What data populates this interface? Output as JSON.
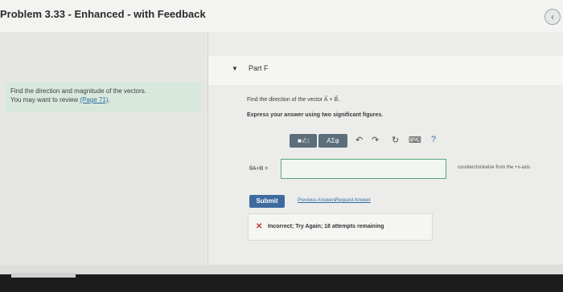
{
  "header": {
    "title": "Problem 3.33 - Enhanced - with Feedback",
    "back_icon": "‹"
  },
  "sidebar": {
    "hint_line1": "Find the direction and magnitude of the vectors.",
    "hint_line2_prefix": "You may want to review ",
    "hint_link": "(Page 71)",
    "hint_line2_suffix": "."
  },
  "part": {
    "caret": "▼",
    "label": "Part F"
  },
  "question": {
    "text": "Find the direction of the vector A⃗ + B⃗.",
    "instruction": "Express your answer using two significant figures."
  },
  "toolbar": {
    "templates_label": "■√□",
    "symbols_label": "ΑΣφ",
    "undo_icon": "↶",
    "redo_icon": "↷",
    "reset_icon": "↻",
    "keyboard_icon": "⌨",
    "help_icon": "?"
  },
  "answer": {
    "label": "θA+B =",
    "value": "",
    "unit": "counterclockwise from the +x-axis"
  },
  "actions": {
    "submit": "Submit",
    "previous_answers": "Previous Answers",
    "request_answer": "Request Answer"
  },
  "feedback": {
    "icon": "✕",
    "message": "Incorrect; Try Again; 18 attempts remaining"
  },
  "colors": {
    "accent": "#3e6aa0",
    "hint_background": "#d8e8dc",
    "error": "#c0392b",
    "input_border": "#5aa57a"
  }
}
